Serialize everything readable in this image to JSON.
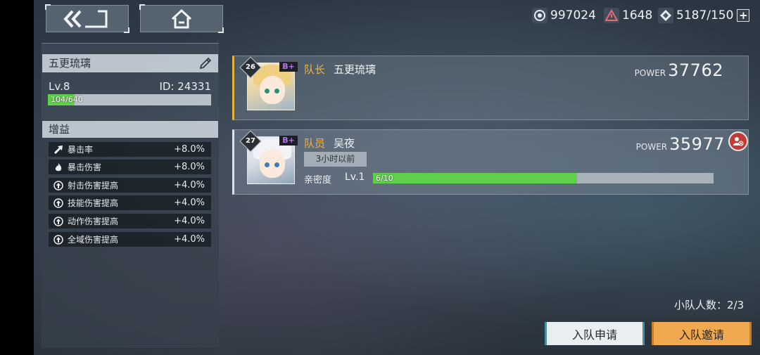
{
  "resources": [
    {
      "icon": "crystal-icon",
      "value": "997024"
    },
    {
      "icon": "warning-triangle-icon",
      "value": "1648"
    },
    {
      "icon": "stamina-icon",
      "value": "5187/150"
    }
  ],
  "profile": {
    "name": "五更琉璃",
    "level": "Lv.8",
    "id": "ID: 24331",
    "xp_text": "104/640",
    "xp_fraction": 0.1625
  },
  "buffs": {
    "title": "增益",
    "items": [
      {
        "label": "暴击率",
        "value": "+8.0%",
        "icon": "arrow-up-right-icon"
      },
      {
        "label": "暴击伤害",
        "value": "+8.0%",
        "icon": "flame-icon"
      },
      {
        "label": "射击伤害提高",
        "value": "+4.0%",
        "icon": "circle-up-icon"
      },
      {
        "label": "技能伤害提高",
        "value": "+4.0%",
        "icon": "circle-up-icon"
      },
      {
        "label": "动作伤害提高",
        "value": "+4.0%",
        "icon": "circle-up-icon"
      },
      {
        "label": "全域伤害提高",
        "value": "+4.0%",
        "icon": "circle-up-icon"
      }
    ]
  },
  "members": [
    {
      "level": "26",
      "rank": "B+",
      "role": "队长",
      "name": "五更琉璃",
      "power_label": "POWER",
      "power": "37762"
    },
    {
      "level": "27",
      "rank": "B+",
      "role": "队员",
      "name": "吴夜",
      "time": "3小时以前",
      "intimacy_label": "亲密度",
      "intimacy_level": "Lv.1",
      "intimacy_text": "6/10",
      "intimacy_fraction": 0.6,
      "power_label": "POWER",
      "power": "35977"
    }
  ],
  "team_count": "小队人数：2/3",
  "buttons": {
    "apply": "入队申请",
    "invite": "入队邀请"
  },
  "colors": {
    "accent_gold": "#f2b33d",
    "progress_green": "#5fd04a",
    "invite_orange": "#f0a94f",
    "rank_purple": "#b875e8",
    "kick_red": "#c23a34"
  }
}
